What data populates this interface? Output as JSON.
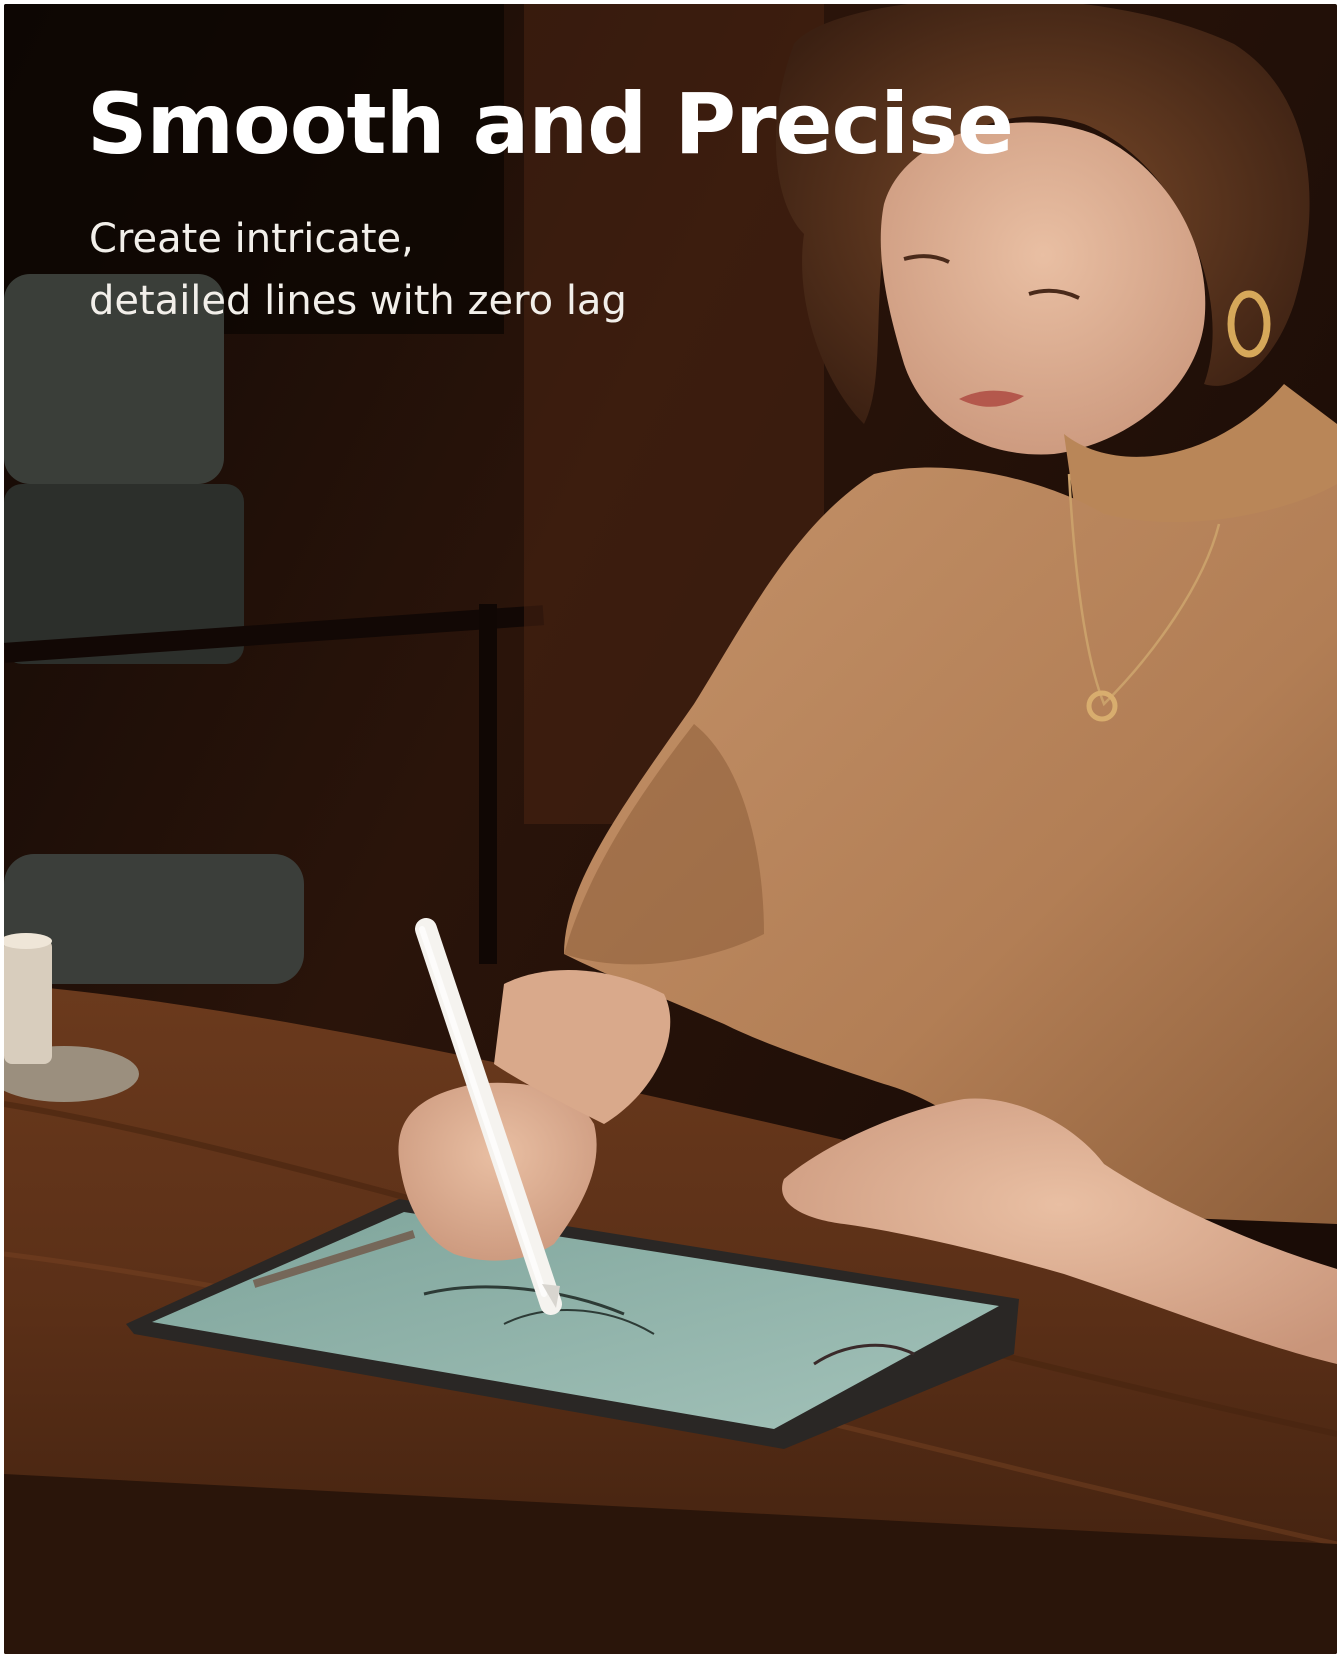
{
  "headline": "Smooth and Precise",
  "subline": {
    "line1": "Create intricate,",
    "line2": "detailed lines with zero lag"
  },
  "colors": {
    "background_dark": "#241208",
    "sweater": "#b88459",
    "table_wood": "#5b3119",
    "tablet_screen": "#8fb2a9",
    "stylus": "#f4f2ee",
    "text": "#ffffff"
  }
}
